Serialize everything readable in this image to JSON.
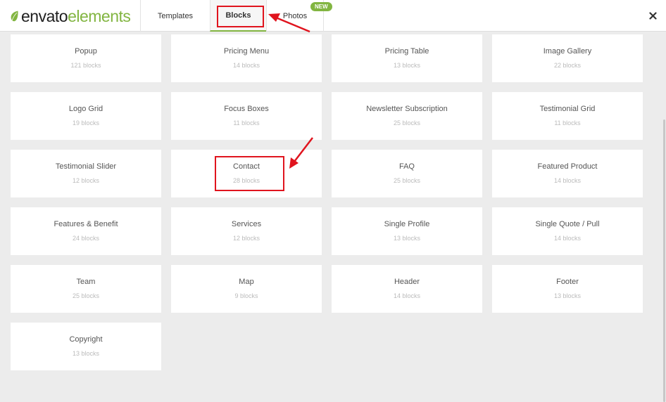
{
  "header": {
    "logo_part1": "envato",
    "logo_part2": "elements",
    "tabs": [
      {
        "label": "Templates"
      },
      {
        "label": "Blocks"
      },
      {
        "label": "Photos"
      }
    ],
    "new_badge": "NEW",
    "close_icon": "close-icon"
  },
  "categories": [
    {
      "title": "Popup",
      "count": "121 blocks"
    },
    {
      "title": "Pricing Menu",
      "count": "14 blocks"
    },
    {
      "title": "Pricing Table",
      "count": "13 blocks"
    },
    {
      "title": "Image Gallery",
      "count": "22 blocks"
    },
    {
      "title": "Logo Grid",
      "count": "19 blocks"
    },
    {
      "title": "Focus Boxes",
      "count": "11 blocks"
    },
    {
      "title": "Newsletter Subscription",
      "count": "25 blocks"
    },
    {
      "title": "Testimonial Grid",
      "count": "11 blocks"
    },
    {
      "title": "Testimonial Slider",
      "count": "12 blocks"
    },
    {
      "title": "Contact",
      "count": "28 blocks"
    },
    {
      "title": "FAQ",
      "count": "25 blocks"
    },
    {
      "title": "Featured Product",
      "count": "14 blocks"
    },
    {
      "title": "Features & Benefit",
      "count": "24 blocks"
    },
    {
      "title": "Services",
      "count": "12 blocks"
    },
    {
      "title": "Single Profile",
      "count": "13 blocks"
    },
    {
      "title": "Single Quote / Pull",
      "count": "14 blocks"
    },
    {
      "title": "Team",
      "count": "25 blocks"
    },
    {
      "title": "Map",
      "count": "9 blocks"
    },
    {
      "title": "Header",
      "count": "14 blocks"
    },
    {
      "title": "Footer",
      "count": "13 blocks"
    },
    {
      "title": "Copyright",
      "count": "13 blocks"
    }
  ],
  "colors": {
    "brand_green": "#82b541",
    "annotation_red": "#e0141e",
    "background": "#ececec"
  }
}
